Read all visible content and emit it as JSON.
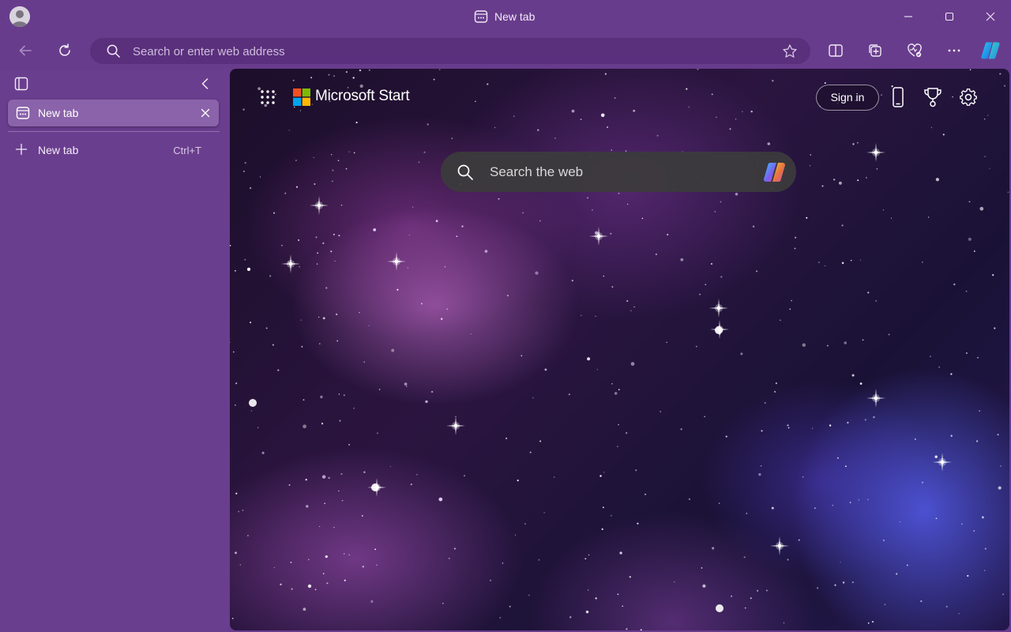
{
  "window": {
    "title": "New tab"
  },
  "toolbar": {
    "address_placeholder": "Search or enter web address",
    "icons": [
      "back-icon",
      "refresh-icon",
      "split-screen-icon",
      "collections-icon",
      "browser-essentials-icon",
      "more-icon",
      "copilot-icon"
    ]
  },
  "sidebar": {
    "tabs": [
      {
        "label": "New tab",
        "active": true
      }
    ],
    "new_tab": {
      "label": "New tab",
      "shortcut": "Ctrl+T"
    }
  },
  "start_page": {
    "brand": "Microsoft Start",
    "sign_in_label": "Sign in",
    "search_placeholder": "Search the web"
  },
  "colors": {
    "frame": "#683c8c",
    "address_bar": "#5a2f7c",
    "active_tab": "#8a63aa",
    "search_box": "#3c3c3c"
  }
}
